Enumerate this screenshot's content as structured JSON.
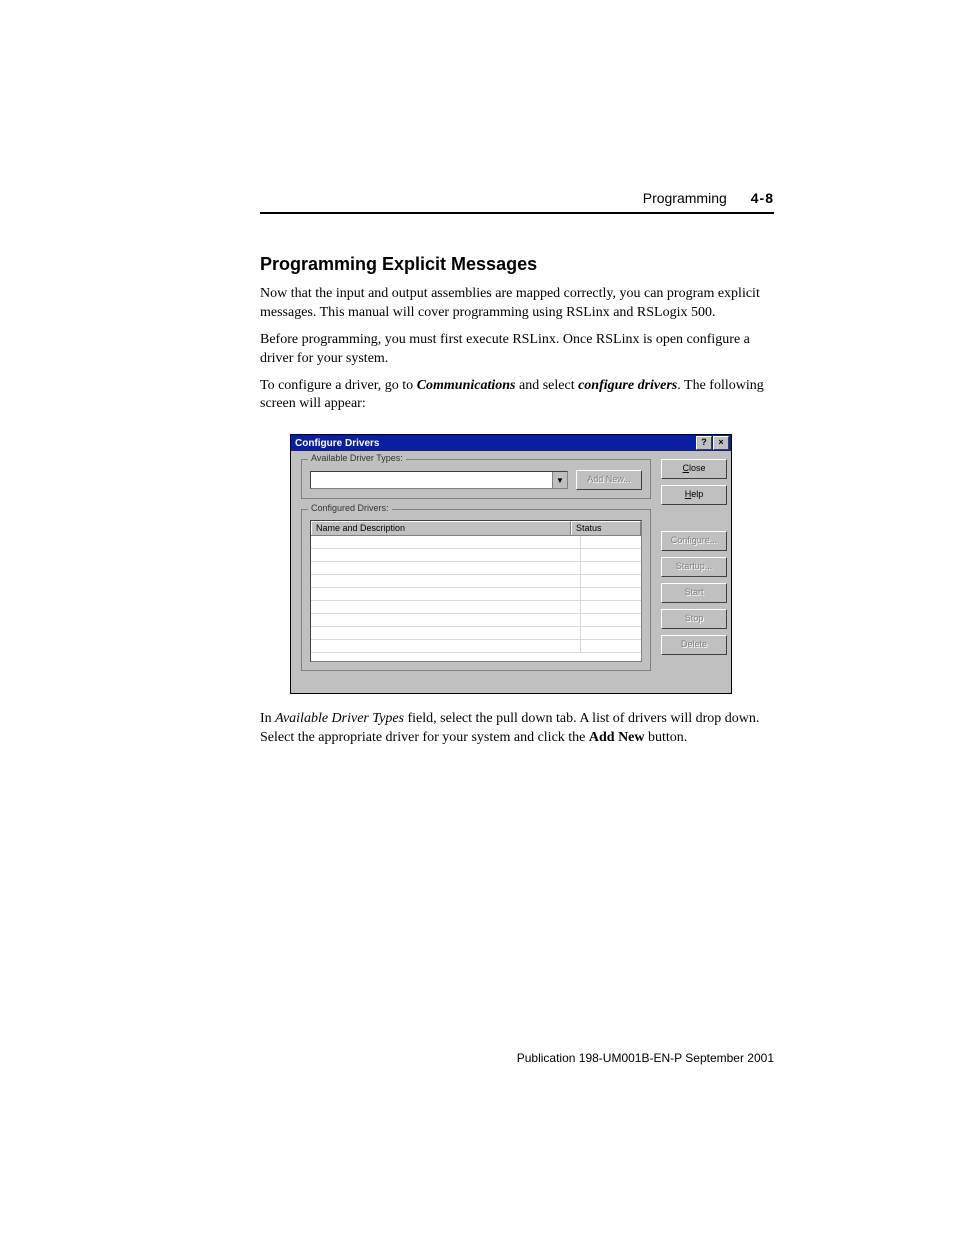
{
  "header": {
    "chapter": "Programming",
    "page": "4-8"
  },
  "section_title": "Programming Explicit Messages",
  "para1": "Now that the input and output assemblies are mapped correctly, you can program explicit messages. This manual will cover programming using RSLinx and RSLogix 500.",
  "para2": "Before programming, you must first execute RSLinx. Once RSLinx is open configure a driver for your system.",
  "para3_pre": "To configure a driver, go to ",
  "para3_b1": "Communications",
  "para3_mid": " and select ",
  "para3_b2": "configure drivers",
  "para3_post": ". The following screen will appear:",
  "dialog": {
    "title": "Configure Drivers",
    "help_glyph": "?",
    "close_glyph": "×",
    "group1_label": "Available Driver Types:",
    "dropdown_glyph": "▼",
    "add_new": "Add New...",
    "close_btn": "Close",
    "help_btn": "Help",
    "group2_label": "Configured Drivers:",
    "col_name": "Name and Description",
    "col_status": "Status",
    "configure_btn": "Configure...",
    "startup_btn": "Startup...",
    "start_btn": "Start",
    "stop_btn": "Stop",
    "delete_btn": "Delete"
  },
  "para4_pre": "In ",
  "para4_i1": "Available Driver Types",
  "para4_mid": " field, select the pull down tab. A list of drivers will drop down. Select the appropriate driver for your system and click the ",
  "para4_b1": "Add New",
  "para4_post": " button.",
  "footer": "Publication 198-UM001B-EN-P  September 2001"
}
